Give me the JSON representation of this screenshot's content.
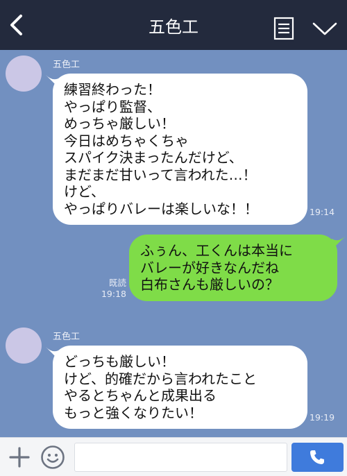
{
  "header": {
    "title": "五色工",
    "back_icon": "chevron-left-icon",
    "note_icon": "note-icon",
    "menu_icon": "chevron-down-icon"
  },
  "messages": [
    {
      "direction": "incoming",
      "sender": "五色工",
      "lines": [
        "練習終わった！",
        "やっぱり監督、",
        "めっちゃ厳しい！",
        "今日はめちゃくちゃ",
        "スパイク決まったんだけど、",
        "まだまだ甘いって言われた…！",
        "けど、",
        "やっぱりバレーは楽しいな！！"
      ],
      "time": "19:14"
    },
    {
      "direction": "outgoing",
      "lines": [
        "ふぅん、工くんは本当に",
        "バレーが好きなんだね",
        "白布さんも厳しいの？"
      ],
      "read_label": "既読",
      "time": "19:18"
    },
    {
      "direction": "incoming",
      "sender": "五色工",
      "lines": [
        "どっちも厳しい！",
        "けど、的確だから言われたこと",
        "やるとちゃんと成果出る",
        "もっと強くなりたい！"
      ],
      "time": "19:19"
    }
  ],
  "footer": {
    "input_value": "",
    "input_placeholder": "",
    "plus_icon": "plus-icon",
    "emoji_icon": "emoji-icon",
    "call_icon": "phone-icon"
  },
  "colors": {
    "header_bg": "#232a3d",
    "chat_bg": "#7290c0",
    "incoming_bubble": "#ffffff",
    "outgoing_bubble": "#7fdc48",
    "call_button": "#3f7bdc"
  }
}
